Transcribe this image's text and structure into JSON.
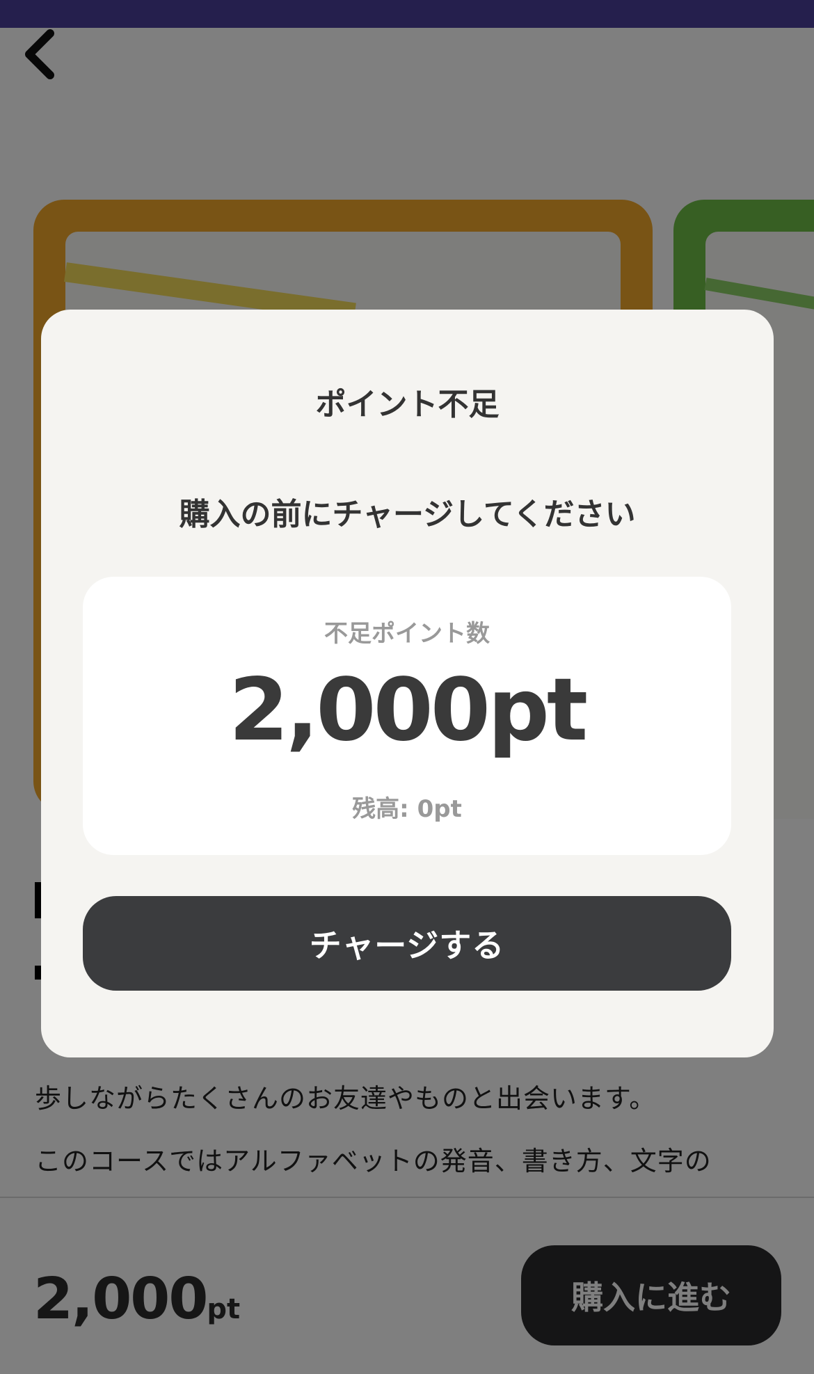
{
  "background_page": {
    "description_lines": [
      "歩しながらたくさんのお友達やものと出会います。",
      "このコースではアルファベットの発音、書き方、文字の"
    ],
    "price_value": "2,000",
    "price_unit": "pt",
    "buy_button_label": "購入に進む"
  },
  "modal": {
    "title": "ポイント不足",
    "message": "購入の前にチャージしてください",
    "points_label": "不足ポイント数",
    "points_value": "2,000pt",
    "balance_text": "残高: 0pt",
    "charge_button_label": "チャージする"
  },
  "colors": {
    "overlay": "rgba(0,0,0,0.5)",
    "modal_background": "#f5f4f1",
    "button_dark": "#3b3c3e",
    "card_orange": "#f3a82a",
    "card_green": "#6fbe47"
  }
}
